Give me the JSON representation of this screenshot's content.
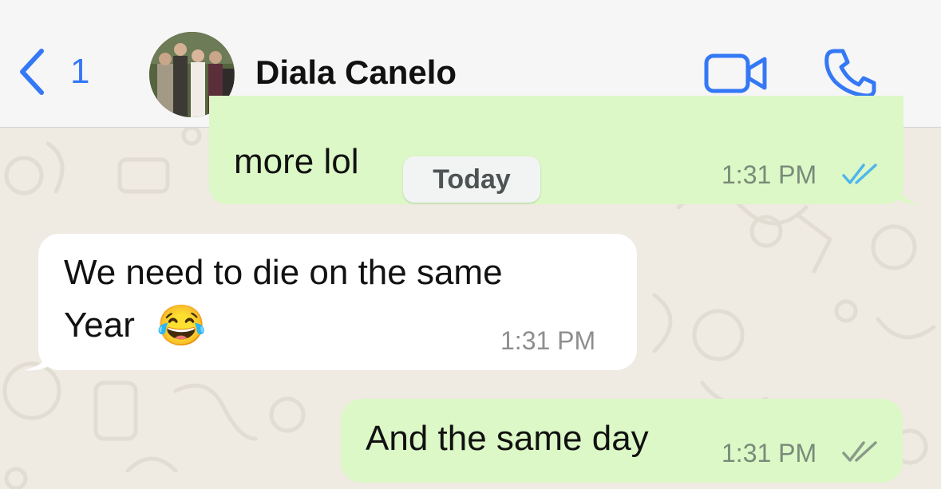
{
  "header": {
    "back_count": "1",
    "contact_name": "Diala Canelo",
    "accent_color": "#3478f6"
  },
  "icons": {
    "back": "chevron-left-icon",
    "video": "video-camera-icon",
    "phone": "phone-icon",
    "read_receipt": "double-check-icon"
  },
  "date_separator": "Today",
  "messages": [
    {
      "direction": "outgoing",
      "text": "more lol",
      "time": "1:31 PM",
      "status": "read"
    },
    {
      "direction": "incoming",
      "text_line1": "We need to die on the same",
      "text_line2": "Year",
      "emoji": "😂",
      "time": "1:31 PM"
    },
    {
      "direction": "outgoing",
      "text": "And the same day",
      "time": "1:31 PM",
      "status": "delivered"
    }
  ],
  "colors": {
    "outgoing_bubble": "#dcf8c6",
    "incoming_bubble": "#ffffff",
    "wallpaper": "#efeae2",
    "read_tick": "#4fb6ec",
    "delivered_tick": "#8a9a8a"
  }
}
